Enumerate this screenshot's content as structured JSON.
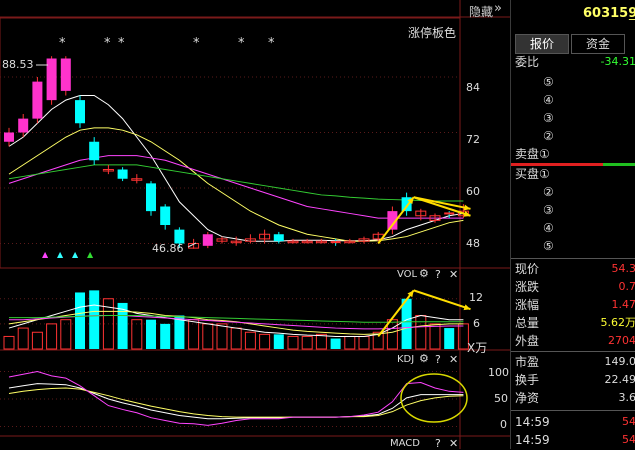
{
  "header": {
    "hide_label": "隐藏",
    "collapse_icon": "double-chevron-right-icon",
    "stock_code": "603159",
    "stock_suffix": "_"
  },
  "main_chart": {
    "limit_color_label": "涨停板色",
    "star_marker": "*",
    "high_price_label": "88.53",
    "low_price_label": "46.86",
    "y_ticks": [
      "84",
      "72",
      "60",
      "48"
    ],
    "arrow_markers": [
      "▲",
      "▲",
      "▲",
      "▲"
    ]
  },
  "vol_panel": {
    "title": "VOL",
    "gear_icon": "gear-icon",
    "help_label": "?",
    "close_label": "✕",
    "y_ticks": [
      "12",
      "6"
    ],
    "unit": "X万"
  },
  "kdj_panel": {
    "title": "KDJ",
    "gear_icon": "gear-icon",
    "help_label": "?",
    "close_label": "✕",
    "y_ticks": [
      "100",
      "50",
      "0"
    ]
  },
  "macd_panel": {
    "title": "MACD",
    "help_label": "?",
    "close_label": "✕"
  },
  "side_panel": {
    "tabs": [
      "报价",
      "资金"
    ],
    "weibi_label": "委比",
    "weibi_value": "-34.31",
    "sell_levels": [
      "⑤",
      "④",
      "③",
      "②"
    ],
    "sell1_label": "卖盘①",
    "buy1_label": "买盘①",
    "buy_levels": [
      "②",
      "③",
      "④",
      "⑤"
    ],
    "stats": [
      {
        "label": "现价",
        "value": "54.3"
      },
      {
        "label": "涨跌",
        "value": "0.7"
      },
      {
        "label": "涨幅",
        "value": "1.47"
      },
      {
        "label": "总量",
        "value": "5.62万"
      },
      {
        "label": "外盘",
        "value": "2704"
      },
      {
        "label": "市盈",
        "value": "149.0"
      },
      {
        "label": "换手",
        "value": "22.49"
      },
      {
        "label": "净资",
        "value": "3.6"
      }
    ],
    "ticks": [
      {
        "time": "14:59",
        "value": "54"
      },
      {
        "time": "14:59",
        "value": "54"
      }
    ]
  },
  "colors": {
    "up": "#ff33cc",
    "down": "#00ffff",
    "red": "#ff3333",
    "yellow": "#ffff33",
    "green": "#33dd33",
    "grid": "#5a1a1a"
  },
  "chart_data": [
    {
      "type": "candlestick",
      "title": "",
      "ylim": [
        44,
        92
      ],
      "high_label": 88.53,
      "low_label": 46.86,
      "candles": [
        {
          "o": 70,
          "c": 72,
          "h": 73,
          "l": 69
        },
        {
          "o": 72,
          "c": 75,
          "h": 76,
          "l": 71
        },
        {
          "o": 75,
          "c": 83,
          "h": 84,
          "l": 74
        },
        {
          "o": 79,
          "c": 88,
          "h": 88.5,
          "l": 78
        },
        {
          "o": 81,
          "c": 88,
          "h": 88.5,
          "l": 80
        },
        {
          "o": 79,
          "c": 74,
          "h": 80,
          "l": 73
        },
        {
          "o": 70,
          "c": 66,
          "h": 71,
          "l": 65
        },
        {
          "o": 64,
          "c": 64,
          "h": 65,
          "l": 63
        },
        {
          "o": 64,
          "c": 62,
          "h": 64.5,
          "l": 61.5
        },
        {
          "o": 62,
          "c": 62,
          "h": 63,
          "l": 61
        },
        {
          "o": 61,
          "c": 55,
          "h": 61.5,
          "l": 54
        },
        {
          "o": 56,
          "c": 52,
          "h": 56.5,
          "l": 51
        },
        {
          "o": 51,
          "c": 48,
          "h": 51.5,
          "l": 47
        },
        {
          "o": 47,
          "c": 48,
          "h": 49,
          "l": 46.86
        },
        {
          "o": 47.5,
          "c": 50,
          "h": 50.5,
          "l": 47
        },
        {
          "o": 48.5,
          "c": 49,
          "h": 49.5,
          "l": 48
        },
        {
          "o": 48.5,
          "c": 48.5,
          "h": 49.5,
          "l": 47.5
        },
        {
          "o": 48.5,
          "c": 49,
          "h": 50,
          "l": 48
        },
        {
          "o": 49,
          "c": 50,
          "h": 51,
          "l": 48
        },
        {
          "o": 50,
          "c": 48.5,
          "h": 50.5,
          "l": 48
        },
        {
          "o": 48.5,
          "c": 48.5,
          "h": 49,
          "l": 48
        },
        {
          "o": 48.5,
          "c": 48.5,
          "h": 49,
          "l": 48
        },
        {
          "o": 48.5,
          "c": 48.5,
          "h": 49,
          "l": 48
        },
        {
          "o": 48.3,
          "c": 48,
          "h": 49,
          "l": 47.5
        },
        {
          "o": 48.5,
          "c": 48.5,
          "h": 49,
          "l": 48
        },
        {
          "o": 48.5,
          "c": 49,
          "h": 49.5,
          "l": 48
        },
        {
          "o": 49,
          "c": 50,
          "h": 50.5,
          "l": 48.5
        },
        {
          "o": 51,
          "c": 55,
          "h": 56,
          "l": 50
        },
        {
          "o": 58,
          "c": 55,
          "h": 59,
          "l": 54
        },
        {
          "o": 54,
          "c": 55,
          "h": 55.5,
          "l": 53
        },
        {
          "o": 53,
          "c": 54,
          "h": 54.5,
          "l": 52.5
        },
        {
          "o": 54.5,
          "c": 54,
          "h": 55,
          "l": 53.5
        },
        {
          "o": 54,
          "c": 55,
          "h": 56.5,
          "l": 53.5
        }
      ],
      "ma_lines": [
        {
          "color": "#ffffff",
          "values": [
            69,
            71,
            74,
            77,
            79,
            80,
            80,
            78,
            75,
            71,
            67,
            62,
            57,
            54,
            51,
            49.5,
            49,
            48.5,
            48.5,
            48.5,
            48.7,
            48.7,
            48.7,
            48.6,
            48.6,
            48.6,
            48.8,
            49.5,
            51,
            52,
            53,
            54,
            54.5
          ]
        },
        {
          "color": "#ffff66",
          "values": [
            63,
            65,
            67,
            69,
            71,
            72.5,
            73,
            73,
            72.5,
            71.5,
            70,
            68,
            66,
            63.5,
            61,
            59,
            57,
            55,
            53.5,
            52,
            51,
            50,
            49.5,
            49,
            48.5,
            48.5,
            48.6,
            49,
            49.5,
            50.5,
            51.5,
            52.5,
            53
          ]
        },
        {
          "color": "#ff44ff",
          "values": [
            61,
            62,
            63,
            64,
            65,
            66,
            66.5,
            67,
            67,
            67,
            66.5,
            66,
            65,
            64,
            63,
            62,
            61,
            60,
            59,
            58,
            57,
            56,
            55.5,
            55,
            54.5,
            54,
            53.5,
            53.5,
            53.5,
            53.5,
            53.5,
            53.5,
            53.5
          ]
        },
        {
          "color": "#33cc33",
          "values": [
            62,
            62.5,
            63,
            63.5,
            64,
            64.5,
            65,
            65,
            65,
            65,
            64.5,
            64,
            63.5,
            63,
            62.5,
            62,
            61.5,
            61,
            60.5,
            60,
            59.5,
            59,
            58.5,
            58.3,
            58,
            57.8,
            57.6,
            57.5,
            57.4,
            57.3,
            57.2,
            57.2,
            57.2
          ]
        }
      ],
      "annotations": [
        {
          "type": "arrow",
          "from": [
            26,
            48
          ],
          "to": [
            28.5,
            58
          ],
          "color": "#ffdd00"
        },
        {
          "type": "arrow",
          "from": [
            28.5,
            58
          ],
          "to": [
            32.5,
            54
          ],
          "color": "#ffdd00"
        },
        {
          "type": "arrow",
          "from": [
            28.5,
            58
          ],
          "to": [
            32.5,
            55.5
          ],
          "color": "#ffdd00"
        }
      ]
    },
    {
      "type": "bar",
      "title": "VOL",
      "unit": "万",
      "ylim": [
        0,
        16
      ],
      "values": [
        3,
        5,
        4,
        6,
        7,
        13.5,
        14,
        12,
        11,
        7,
        7,
        6,
        8,
        7,
        6,
        6,
        5,
        4,
        3.5,
        3.5,
        3,
        3,
        3.5,
        2.5,
        3,
        3,
        4,
        7,
        12,
        8,
        6,
        5,
        6
      ]
    },
    {
      "type": "line",
      "title": "KDJ",
      "ylim": [
        -10,
        110
      ],
      "series": [
        {
          "color": "#ffffff",
          "values": [
            70,
            74,
            78,
            77,
            76,
            70,
            60,
            50,
            43,
            37,
            30,
            25,
            20,
            17,
            14,
            14,
            15,
            16,
            16,
            16,
            17,
            17,
            17,
            17,
            18,
            19,
            22,
            33,
            52,
            58,
            58,
            58,
            58
          ]
        },
        {
          "color": "#ffff66",
          "values": [
            60,
            64,
            67,
            69,
            70,
            68,
            62,
            56,
            49,
            43,
            37,
            32,
            27,
            23,
            20,
            18,
            17,
            17,
            17,
            17,
            17,
            17,
            17,
            17,
            18,
            18,
            20,
            27,
            39,
            47,
            52,
            55,
            56
          ]
        },
        {
          "color": "#ff44ff",
          "values": [
            90,
            95,
            100,
            92,
            88,
            74,
            56,
            38,
            31,
            25,
            16,
            11,
            6,
            5,
            2,
            6,
            11,
            14,
            14,
            14,
            17,
            17,
            17,
            17,
            18,
            21,
            26,
            45,
            78,
            80,
            70,
            64,
            62
          ]
        }
      ]
    }
  ]
}
